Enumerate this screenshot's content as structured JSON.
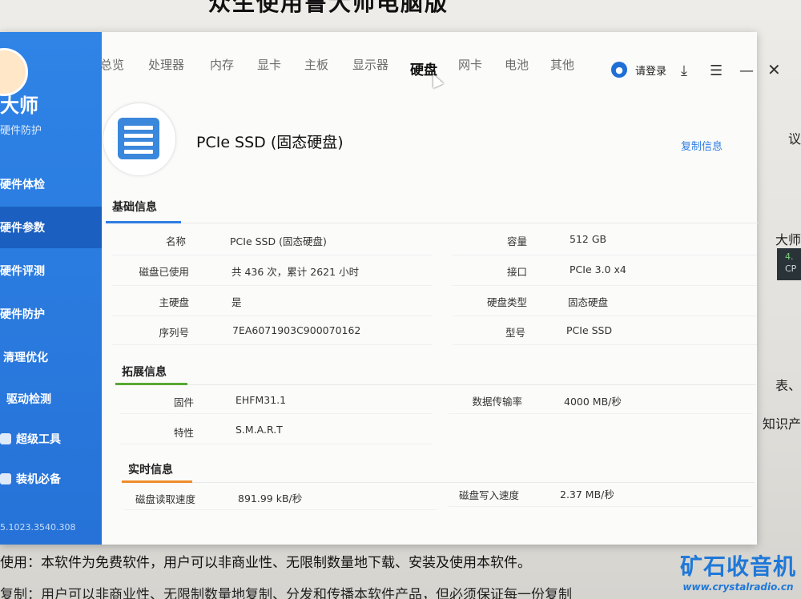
{
  "background": {
    "title_fragment": "众生使用鲁大师电脑版",
    "side_fragments": [
      "议",
      "大师",
      "表、",
      "知识产"
    ],
    "side_badge": [
      "4.",
      "CP"
    ],
    "footer_line1": "使用：本软件为免费软件，用户可以非商业性、无限制数量地下载、安装及使用本软件。",
    "footer_line2": "复制：用户可以非商业性、无限制数量地复制、分发和传播本软件产品，但必须保证每一份复制",
    "watermark_main": "矿石收音机",
    "watermark_url": "www.crystalradio.cn"
  },
  "sidebar": {
    "logo_text": "大师",
    "logo_sub": "硬件防护",
    "items": [
      {
        "label": "硬件体检"
      },
      {
        "label": "硬件参数"
      },
      {
        "label": "硬件评测"
      },
      {
        "label": "硬件防护"
      },
      {
        "label": "清理优化"
      },
      {
        "label": "驱动检测"
      },
      {
        "label": "超级工具"
      },
      {
        "label": "装机必备"
      }
    ],
    "version": "5.1023.3540.308"
  },
  "tabs": [
    {
      "label": "总览"
    },
    {
      "label": "处理器"
    },
    {
      "label": "内存"
    },
    {
      "label": "显卡"
    },
    {
      "label": "主板"
    },
    {
      "label": "显示器"
    },
    {
      "label": "硬盘"
    },
    {
      "label": "网卡"
    },
    {
      "label": "电池"
    },
    {
      "label": "其他"
    }
  ],
  "active_tab": "硬盘",
  "header": {
    "login_label": "请登录",
    "download_icon": "download-icon",
    "menu_icon": "menu-icon",
    "minimize_icon": "minimize-icon",
    "close_icon": "close-icon"
  },
  "device": {
    "icon": "ssd-icon",
    "title": "PCIe SSD (固态硬盘)",
    "copy_label": "复制信息"
  },
  "basic": {
    "title": "基础信息",
    "rows": [
      {
        "label": "名称",
        "value": "PCIe SSD (固态硬盘)",
        "label2": "容量",
        "value2": "512 GB"
      },
      {
        "label": "磁盘已使用",
        "value": "共 436 次，累计 2621 小时",
        "label2": "接口",
        "value2": "PCIe 3.0 x4"
      },
      {
        "label": "主硬盘",
        "value": "是",
        "label2": "硬盘类型",
        "value2": "固态硬盘"
      },
      {
        "label": "序列号",
        "value": "7EA6071903C900070162",
        "label2": "型号",
        "value2": "PCIe SSD"
      }
    ]
  },
  "extended": {
    "title": "拓展信息",
    "rows": [
      {
        "label": "固件",
        "value": "EHFM31.1",
        "label2": "数据传输率",
        "value2": "4000 MB/秒"
      },
      {
        "label": "特性",
        "value": "S.M.A.R.T",
        "label2": "",
        "value2": ""
      }
    ]
  },
  "realtime": {
    "title": "实时信息",
    "rows": [
      {
        "label": "磁盘读取速度",
        "value": "891.99 kB/秒",
        "label2": "磁盘写入速度",
        "value2": "2.37 MB/秒"
      }
    ]
  },
  "colors": {
    "sidebar": "#2a78de",
    "accent": "#2f7de0",
    "basic_underline": "#2f7de0",
    "extended_underline": "#5aa832",
    "realtime_underline": "#f08c2a"
  }
}
